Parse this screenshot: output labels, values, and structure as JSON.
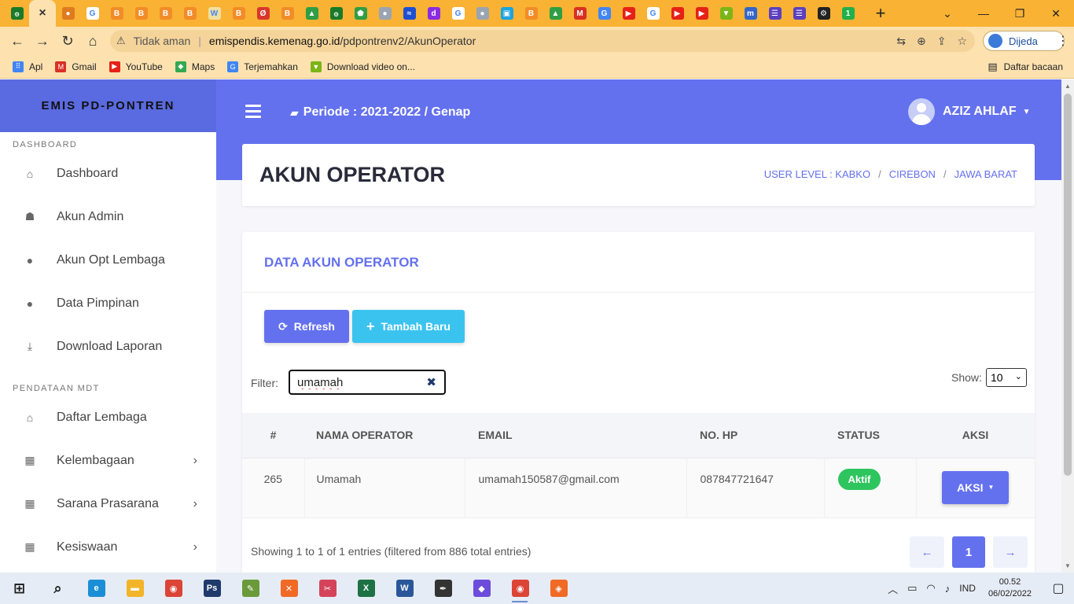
{
  "browser": {
    "active_tab_close": "×",
    "new_tab": "+",
    "controls": {
      "minimize": "—",
      "maximize": "❐",
      "close": "✕",
      "tab_search": "⌄"
    },
    "tabs": [
      {
        "color": "#1b7a2a",
        "glyph": "۞"
      },
      {
        "color": "#e07a1f",
        "glyph": "●"
      },
      {
        "color": "#ffffff",
        "glyph": "G"
      },
      {
        "color": "#f28c28",
        "glyph": "B"
      },
      {
        "color": "#f28c28",
        "glyph": "B"
      },
      {
        "color": "#f28c28",
        "glyph": "B"
      },
      {
        "color": "#f28c28",
        "glyph": "B"
      },
      {
        "color": "#f0e0a0",
        "glyph": "W"
      },
      {
        "color": "#f28c28",
        "glyph": "B"
      },
      {
        "color": "#d9362b",
        "glyph": "Ø"
      },
      {
        "color": "#f28c28",
        "glyph": "B"
      },
      {
        "color": "#2f9e44",
        "glyph": "▲"
      },
      {
        "color": "#1b7a2a",
        "glyph": "۞"
      },
      {
        "color": "#2f9e44",
        "glyph": "⬟"
      },
      {
        "color": "#9aa4b2",
        "glyph": "●"
      },
      {
        "color": "#1e4fd1",
        "glyph": "≈"
      },
      {
        "color": "#8a2be2",
        "glyph": "d"
      },
      {
        "color": "#ffffff",
        "glyph": "G"
      },
      {
        "color": "#9aa4b2",
        "glyph": "●"
      },
      {
        "color": "#1aa3e0",
        "glyph": "▣"
      },
      {
        "color": "#f28c28",
        "glyph": "B"
      },
      {
        "color": "#2f9e44",
        "glyph": "▲"
      },
      {
        "color": "#d93025",
        "glyph": "M"
      },
      {
        "color": "#4285f4",
        "glyph": "G"
      },
      {
        "color": "#e62117",
        "glyph": "▶"
      },
      {
        "color": "#ffffff",
        "glyph": "G"
      },
      {
        "color": "#e62117",
        "glyph": "▶"
      },
      {
        "color": "#e62117",
        "glyph": "▶"
      },
      {
        "color": "#7cb518",
        "glyph": "▼"
      },
      {
        "color": "#3366cc",
        "glyph": "m"
      },
      {
        "color": "#5b3fbf",
        "glyph": "☰"
      },
      {
        "color": "#5b3fbf",
        "glyph": "☰"
      },
      {
        "color": "#222222",
        "glyph": "⚙"
      },
      {
        "color": "#21b04b",
        "glyph": "1"
      }
    ],
    "nav": {
      "back": "←",
      "forward": "→",
      "reload": "↻",
      "home": "⌂"
    },
    "address": {
      "warning_icon": "⚠",
      "insecure_label": "Tidak aman",
      "separator": "|",
      "host": "emispendis.kemenag.go.id",
      "path": "/pdpontrenv2/AkunOperator",
      "icons": [
        "translate-icon",
        "zoom-icon",
        "share-icon",
        "star-icon"
      ],
      "icon_glyphs": [
        "⇆",
        "⊕",
        "⇪",
        "☆"
      ]
    },
    "profile_label": "Dijeda",
    "menu": "⋮",
    "bookmarks": [
      {
        "label": "Apl",
        "color": "#4285f4",
        "glyph": "⠿"
      },
      {
        "label": "Gmail",
        "color": "#d93025",
        "glyph": "M"
      },
      {
        "label": "YouTube",
        "color": "#e62117",
        "glyph": "▶"
      },
      {
        "label": "Maps",
        "color": "#34a853",
        "glyph": "◆"
      },
      {
        "label": "Terjemahkan",
        "color": "#4285f4",
        "glyph": "G"
      },
      {
        "label": "Download video on...",
        "color": "#7cb518",
        "glyph": "▼"
      }
    ],
    "reading_list": {
      "icon": "▤",
      "label": "Daftar bacaan"
    }
  },
  "sidebar": {
    "brand": "EMIS PD-PONTREN",
    "sections": [
      {
        "label": "DASHBOARD",
        "items": [
          {
            "label": "Dashboard",
            "icon": "home-icon",
            "glyph": "⌂",
            "has_chevron": false
          },
          {
            "label": "Akun Admin",
            "icon": "user-secret-icon",
            "glyph": "☗",
            "has_chevron": false
          },
          {
            "label": "Akun Opt Lembaga",
            "icon": "user-icon",
            "glyph": "●",
            "has_chevron": false
          },
          {
            "label": "Data Pimpinan",
            "icon": "user-icon",
            "glyph": "●",
            "has_chevron": false
          },
          {
            "label": "Download Laporan",
            "icon": "download-icon",
            "glyph": "⤓",
            "has_chevron": false
          }
        ]
      },
      {
        "label": "PENDATAAN MDT",
        "items": [
          {
            "label": "Daftar Lembaga",
            "icon": "institution-icon",
            "glyph": "⌂",
            "has_chevron": false
          },
          {
            "label": "Kelembagaan",
            "icon": "table-icon",
            "glyph": "▦",
            "has_chevron": true
          },
          {
            "label": "Sarana Prasarana",
            "icon": "table-icon",
            "glyph": "▦",
            "has_chevron": true
          },
          {
            "label": "Kesiswaan",
            "icon": "table-icon",
            "glyph": "▦",
            "has_chevron": true
          }
        ]
      }
    ],
    "chevron": "›"
  },
  "header": {
    "folder_icon": "▰",
    "periode": "Periode : 2021-2022 / Genap",
    "user_name": "AZIZ AHLAF",
    "user_caret": "▼"
  },
  "title_card": {
    "title": "AKUN OPERATOR",
    "breadcrumbs": [
      "USER LEVEL : KABKO",
      "CIREBON",
      "JAWA BARAT"
    ],
    "crumb_separator": "/"
  },
  "data_card": {
    "title": "DATA AKUN OPERATOR",
    "refresh_label": "Refresh",
    "refresh_icon": "⟳",
    "add_label": "Tambah Baru",
    "add_icon": "+",
    "filter_label": "Filter:",
    "filter_value": "umamah",
    "clear_icon": "✖",
    "show_label": "Show:",
    "show_value": "10",
    "show_caret": "⌄",
    "columns": [
      "#",
      "NAMA OPERATOR",
      "EMAIL",
      "NO. HP",
      "STATUS",
      "AKSI"
    ],
    "rows": [
      {
        "no": "265",
        "nama": "Umamah",
        "email": "umamah150587@gmail.com",
        "hp": "087847721647",
        "status": "Aktif",
        "aksi": "AKSI"
      }
    ],
    "aksi_caret": "▼",
    "info": "Showing 1 to 1 of 1 entries (filtered from 886 total entries)",
    "pager": {
      "prev": "←",
      "current": "1",
      "next": "→"
    }
  },
  "taskbar": {
    "apps": [
      {
        "name": "start-icon",
        "color": "#1a1a1a",
        "glyph": "⊞",
        "running": false
      },
      {
        "name": "search-icon",
        "color": "#1a1a1a",
        "glyph": "⌕",
        "running": false
      },
      {
        "name": "edge-icon",
        "color": "#1a8fd6",
        "glyph": "e",
        "running": false
      },
      {
        "name": "file-explorer-icon",
        "color": "#f2b529",
        "glyph": "▬",
        "running": false
      },
      {
        "name": "chrome-icon",
        "color": "#db4437",
        "glyph": "◉",
        "running": false
      },
      {
        "name": "photoshop-icon",
        "color": "#1f3a6b",
        "glyph": "Ps",
        "running": false
      },
      {
        "name": "notepad-icon",
        "color": "#6a9a3a",
        "glyph": "✎",
        "running": false
      },
      {
        "name": "xampp-icon",
        "color": "#f06a25",
        "glyph": "✕",
        "running": false
      },
      {
        "name": "scissors-icon",
        "color": "#d4435a",
        "glyph": "✂",
        "running": false
      },
      {
        "name": "excel-icon",
        "color": "#1e7145",
        "glyph": "X",
        "running": false
      },
      {
        "name": "word-icon",
        "color": "#2b579a",
        "glyph": "W",
        "running": false
      },
      {
        "name": "pen-tool-icon",
        "color": "#333333",
        "glyph": "✒",
        "running": false
      },
      {
        "name": "paint-icon",
        "color": "#6c4cdb",
        "glyph": "◆",
        "running": false
      },
      {
        "name": "chrome-active-icon",
        "color": "#db4437",
        "glyph": "◉",
        "running": true
      },
      {
        "name": "sublime-icon",
        "color": "#f06a25",
        "glyph": "◈",
        "running": false
      }
    ],
    "tray": {
      "chevron": "︿",
      "battery": "▭",
      "wifi": "◠",
      "volume": "♪",
      "lang": "IND",
      "time": "00.52",
      "date": "06/02/2022",
      "notifications": "▢"
    }
  }
}
